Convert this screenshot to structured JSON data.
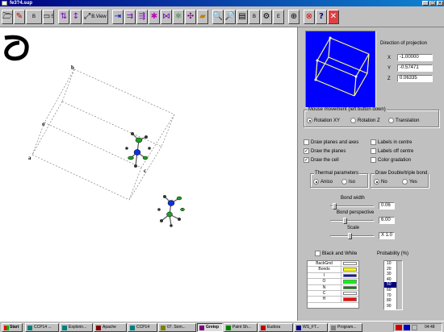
{
  "window": {
    "title": "fe3?4.sup"
  },
  "toolbar": {
    "b_label": "B",
    "s_label": "S",
    "view_label": "B.View",
    "buttons": [
      "open-icon",
      "draw-icon",
      "plane-icon",
      "mirror-icon",
      "view-icon",
      "move-x-icon",
      "move-y-icon",
      "move-xy-icon",
      "atom-icon",
      "bond-icon",
      "molecule-icon",
      "unit-cell-icon",
      "zoom-in-icon",
      "zoom-out-icon",
      "print-icon",
      "render-icon",
      "settings-icon",
      "add-icon",
      "stop-icon",
      "help-icon",
      "close-icon"
    ],
    "extra_labels": [
      "B",
      "E"
    ]
  },
  "canvas": {
    "axis_labels": {
      "a": "a",
      "b": "b",
      "c": "c",
      "o": "o"
    }
  },
  "panel": {
    "direction_title": "Direction of projection",
    "direction": {
      "x_label": "X",
      "x_value": "-1.00000",
      "y_label": "Y",
      "y_value": "-0.57471",
      "z_label": "Z",
      "z_value": "0.06335"
    },
    "mouse_group": {
      "title": "Mouse movement (left button down)",
      "options": [
        "Rotation XY",
        "Rotation Z",
        "Translation"
      ],
      "selected": "Rotation XY"
    },
    "checks_left": [
      {
        "label": "Draw planes and axes",
        "checked": false
      },
      {
        "label": "Draw the planes",
        "checked": true
      },
      {
        "label": "Draw the cell",
        "checked": true
      }
    ],
    "checks_right": [
      {
        "label": "Labels in centre",
        "checked": false
      },
      {
        "label": "Labels off centre",
        "checked": false
      },
      {
        "label": "Color gradation",
        "checked": false
      }
    ],
    "thermal": {
      "title": "Thermal parameters",
      "options": [
        "Aniso",
        "Iso"
      ],
      "selected": "Aniso"
    },
    "bond_type": {
      "title": "Draw Double/triple bond",
      "options": [
        "No",
        "Yes"
      ],
      "selected": "No"
    },
    "bond_width": {
      "label": "Bond width",
      "value": "0.06"
    },
    "bond_perspective": {
      "label": "Bond perspective",
      "value": "6.00"
    },
    "scale": {
      "label": "Scale",
      "value": "X 1.0"
    },
    "black_white": {
      "label": "Black and White",
      "checked": false
    },
    "probability_label": "Probability (%)",
    "probability_options": [
      "10",
      "20",
      "30",
      "40",
      "50",
      "60",
      "70",
      "80",
      "90"
    ],
    "probability_selected": "50",
    "colors": [
      {
        "name": "BackGnd",
        "color": "#ffffff"
      },
      {
        "name": "Bonds",
        "color": "#ffff00"
      },
      {
        "name": "I",
        "color": "#0000ff"
      },
      {
        "name": "O",
        "color": "#00ff00"
      },
      {
        "name": "N",
        "color": "#008000"
      },
      {
        "name": "C",
        "color": "#ffffff"
      },
      {
        "name": "H",
        "color": "#ff0000"
      }
    ]
  },
  "taskbar": {
    "start": "Start",
    "tasks": [
      "CCP14 ...",
      "Explorin...",
      "Apache",
      "CCP14",
      "07. Som...",
      "Gretep",
      "Paint Sh...",
      "Eudora",
      "WS_FT...",
      "Program..."
    ],
    "active": "Gretep",
    "clock": "04:48"
  }
}
